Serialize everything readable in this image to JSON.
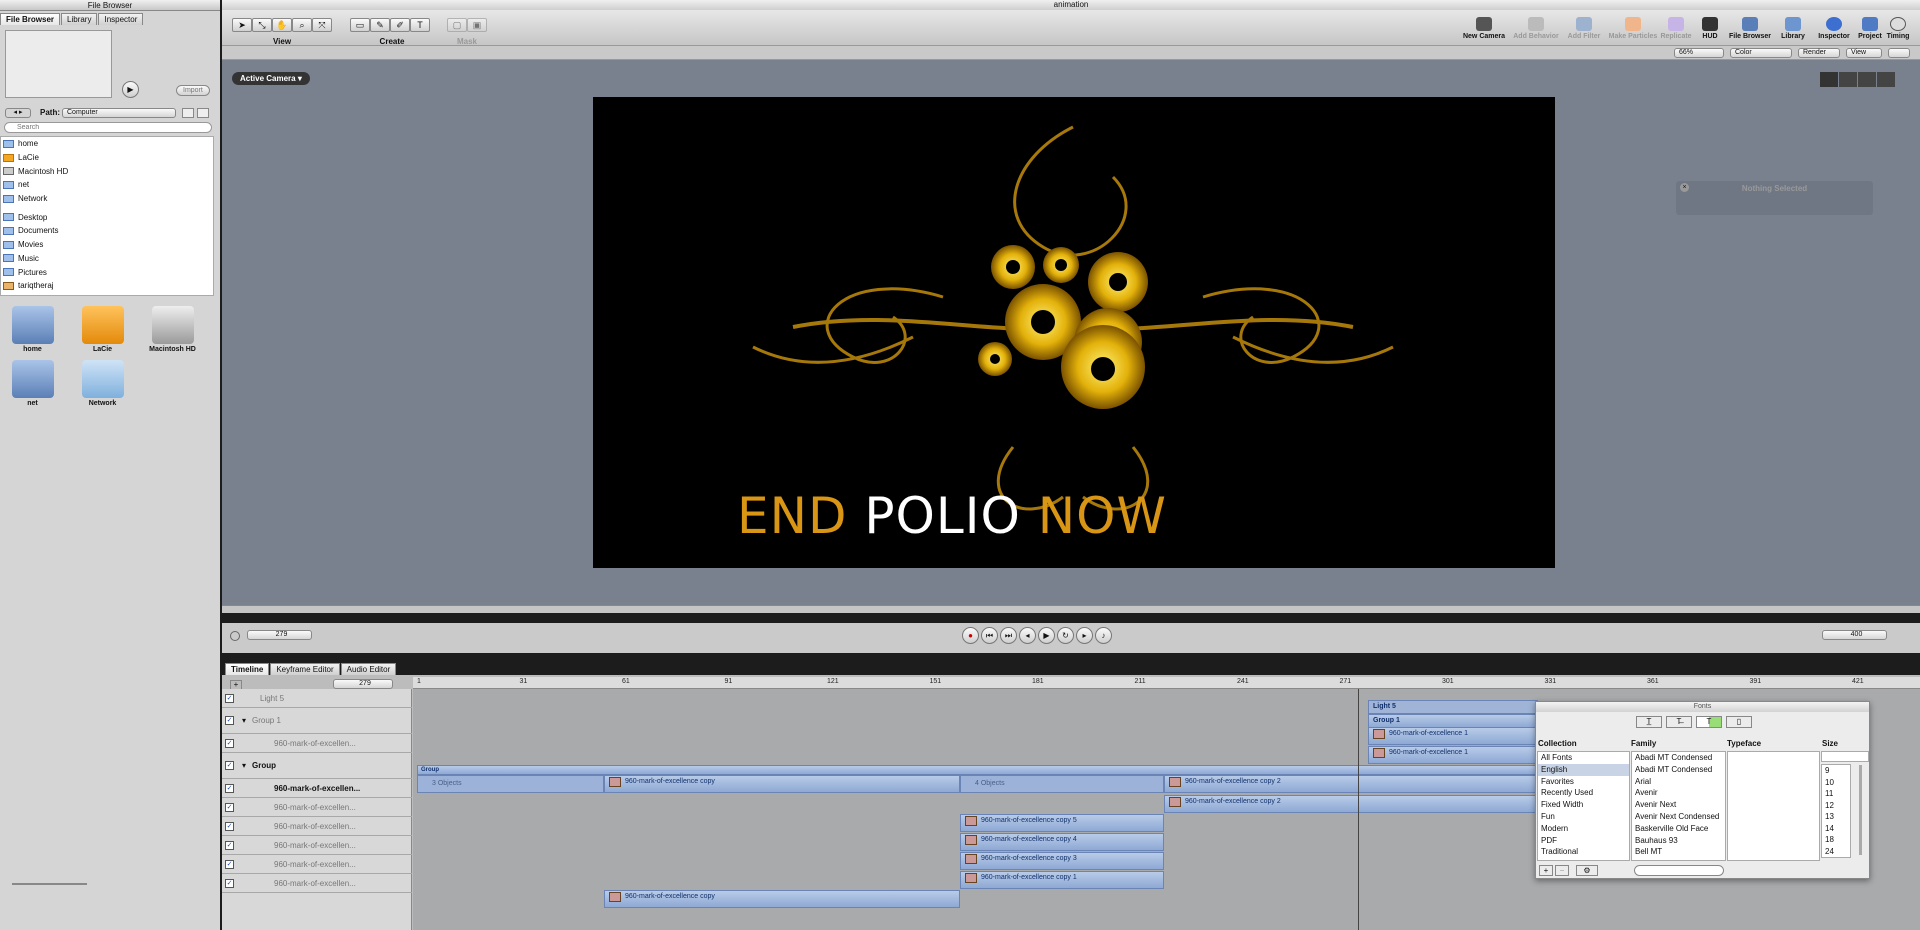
{
  "left": {
    "title": "File Browser",
    "tabs": [
      "File Browser",
      "Library",
      "Inspector"
    ],
    "import_label": "Import",
    "path_label": "Path:",
    "path_value": "Computer",
    "search_placeholder": "Search",
    "sources": [
      "home",
      "LaCie",
      "Macintosh HD",
      "net",
      "Network"
    ],
    "folders": [
      "Desktop",
      "Documents",
      "Movies",
      "Music",
      "Pictures",
      "tariqtheraj"
    ],
    "volumes": [
      "home",
      "LaCie",
      "Macintosh HD",
      "net",
      "Network"
    ]
  },
  "window": {
    "title": "animation"
  },
  "toolbar": {
    "groups": [
      "View",
      "Create",
      "Mask"
    ],
    "right_items": [
      "New Camera",
      "Add Behavior",
      "Add Filter",
      "Make Particles",
      "Replicate",
      "HUD",
      "File Browser",
      "Library",
      "Inspector",
      "Project",
      "Timing"
    ],
    "zoom": "66%",
    "color": "Color",
    "render": "Render",
    "view": "View"
  },
  "viewer": {
    "camera": "Active Camera",
    "canvas_words": [
      "END",
      "POLIO",
      "NOW"
    ],
    "hud_text": "Nothing Selected"
  },
  "transport": {
    "current_frame": "279",
    "end_frame": "400"
  },
  "timeline": {
    "tabs": [
      "Timeline",
      "Keyframe Editor",
      "Audio Editor"
    ],
    "frame_field": "279",
    "ruler": [
      "1",
      "31",
      "61",
      "91",
      "121",
      "151",
      "181",
      "211",
      "241",
      "271",
      "301",
      "331",
      "361",
      "391",
      "421"
    ],
    "layers": [
      "Light 5",
      "Group 1",
      "960-mark-of-excellen...",
      "Group",
      "960-mark-of-excellen...",
      "960-mark-of-excellen...",
      "960-mark-of-excellen...",
      "960-mark-of-excellen...",
      "960-mark-of-excellen...",
      "960-mark-of-excellen..."
    ],
    "clips": {
      "light": "Light 5",
      "group1": "Group 1",
      "group1_c1": "960-mark-of-excellence 1",
      "group1_c2": "960-mark-of-excellence 1",
      "group": "Group",
      "obj3": "3 Objects",
      "copy": "960-mark-of-excellence copy",
      "obj4": "4 Objects",
      "copy2a": "960-mark-of-excellence copy 2",
      "copy2b": "960-mark-of-excellence copy 2",
      "c5": "960-mark-of-excellence copy 5",
      "c4": "960-mark-of-excellence copy 4",
      "c3": "960-mark-of-excellence copy 3",
      "c1": "960-mark-of-excellence copy 1",
      "copyb": "960-mark-of-excellence copy"
    }
  },
  "fonts": {
    "title": "Fonts",
    "headers": [
      "Collection",
      "Family",
      "Typeface",
      "Size"
    ],
    "collections": [
      "All Fonts",
      "English",
      "Favorites",
      "Recently Used",
      "Fixed Width",
      "Fun",
      "Modern",
      "PDF",
      "Traditional"
    ],
    "families": [
      "Abadi MT Condensed",
      "Abadi MT Condensed",
      "Arial",
      "Avenir",
      "Avenir Next",
      "Avenir Next Condensed",
      "Baskerville Old Face",
      "Bauhaus 93",
      "Bell MT"
    ],
    "sizes": [
      "9",
      "10",
      "11",
      "12",
      "13",
      "14",
      "18",
      "24"
    ]
  }
}
